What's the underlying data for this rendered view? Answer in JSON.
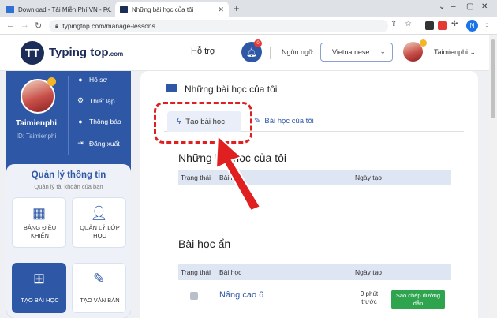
{
  "browser": {
    "tabs": [
      {
        "title": "Download - Tải Miễn Phí VN - P...",
        "active": false
      },
      {
        "title": "Những bài học của tôi",
        "active": true
      }
    ],
    "new_tab": "+",
    "url": "typingtop.com/manage-lessons",
    "profile_initial": "N"
  },
  "header": {
    "logo_mark": "TT",
    "logo_name": "Typing top",
    "logo_suffix": ".com",
    "support": "Hỗ trợ",
    "notif_count": "0",
    "language_label": "Ngôn ngữ",
    "language_value": "Vietnamese",
    "username": "Taimienphi"
  },
  "sidebar": {
    "name": "Taimienphi",
    "id": "ID: Taimienphi",
    "links": [
      {
        "label": "Hồ sơ",
        "icon": "user-icon"
      },
      {
        "label": "Thiết lập",
        "icon": "gear-icon"
      },
      {
        "label": "Thông báo",
        "icon": "bell-icon"
      },
      {
        "label": "Đăng xuất",
        "icon": "logout-icon"
      }
    ],
    "info_title": "Quản lý thông tin",
    "info_subtitle": "Quản lý tài khoản của bạn",
    "tiles": [
      {
        "label": "BẢNG ĐIỀU KHIỂN",
        "icon": "dashboard-icon",
        "active": false
      },
      {
        "label": "QUẢN LÝ LỚP HỌC",
        "icon": "class-manage-icon",
        "active": false
      },
      {
        "label": "TẠO BÀI HỌC",
        "icon": "create-lesson-icon",
        "active": true
      },
      {
        "label": "TẠO VĂN BẢN",
        "icon": "create-text-icon",
        "active": false
      }
    ]
  },
  "main": {
    "title": "Những bài học của tôi",
    "tab_create": "Tạo bài học",
    "tab_mine": "Bài học của tôi",
    "section1_title": "Những bài học của tôi",
    "section2_title": "Bài học ẩn",
    "columns": {
      "status": "Trạng thái",
      "lesson": "Bài học",
      "date": "Ngày tạo"
    },
    "hidden_rows": [
      {
        "lesson": "Nâng cao 6",
        "time": "9 phút trước",
        "action": "Sao chép đường dẫn"
      }
    ]
  },
  "colors": {
    "brand": "#2e57a6",
    "highlight": "#e02020",
    "success": "#2ea44f"
  }
}
